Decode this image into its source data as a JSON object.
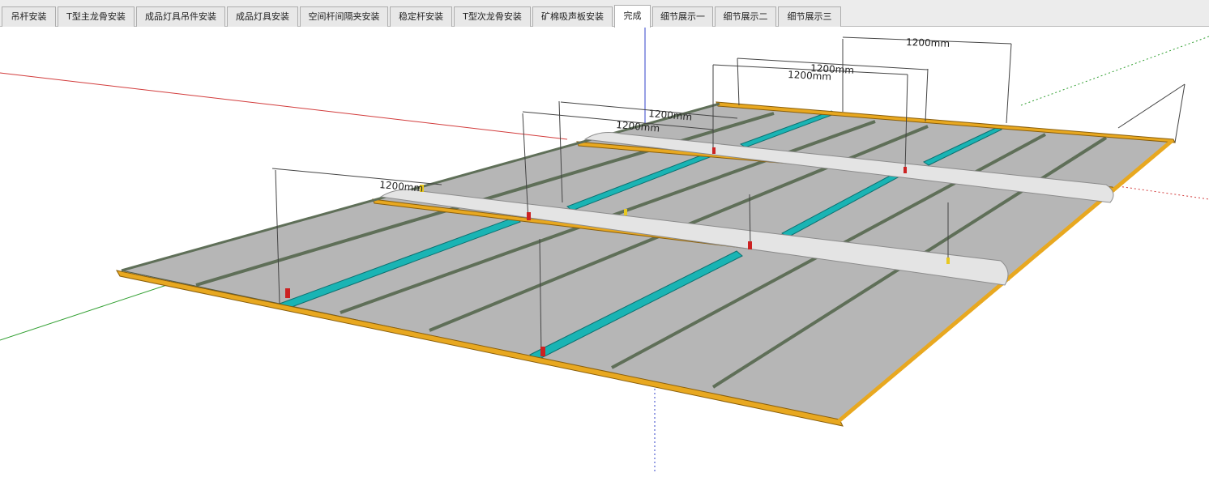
{
  "tabs": [
    {
      "label": "吊杆安装"
    },
    {
      "label": "T型主龙骨安装"
    },
    {
      "label": "成品灯具吊件安装"
    },
    {
      "label": "成品灯具安装"
    },
    {
      "label": "空间杆间隔夹安装"
    },
    {
      "label": "稳定杆安装"
    },
    {
      "label": "T型次龙骨安装"
    },
    {
      "label": "矿棉吸声板安装"
    },
    {
      "label": "完成",
      "active": true
    },
    {
      "label": "细节展示一"
    },
    {
      "label": "细节展示二"
    },
    {
      "label": "细节展示三"
    }
  ],
  "dimensions": [
    {
      "label": "1200mm"
    },
    {
      "label": "1200mm"
    },
    {
      "label": "1200mm"
    },
    {
      "label": "1200mm"
    },
    {
      "label": "1200mm"
    },
    {
      "label": "1200mm"
    }
  ],
  "colors": {
    "main_runner": "#e8a820",
    "cross_tee": "#5f6f58",
    "panel": "#b6b6b6",
    "light_fixture": "#19b4b4",
    "stabilizer_bar": "#e4e4e4",
    "axis_red": "#d23c3c",
    "axis_green": "#32a032",
    "axis_blue": "#3240c8"
  },
  "scene": {
    "description_icon": "3d-ceiling-grid-model"
  }
}
